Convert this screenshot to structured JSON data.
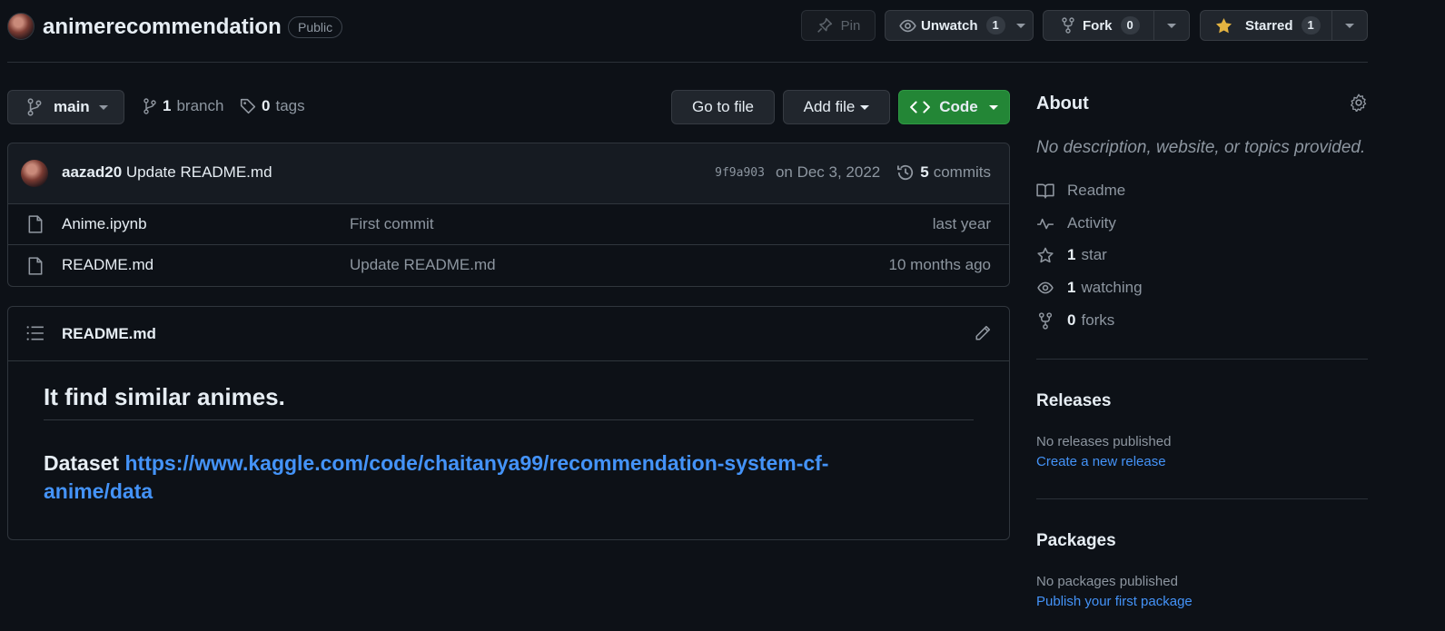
{
  "repo": {
    "name": "animerecommendation",
    "visibility": "Public"
  },
  "header_actions": {
    "pin_label": "Pin",
    "unwatch_label": "Unwatch",
    "unwatch_count": "1",
    "fork_label": "Fork",
    "fork_count": "0",
    "starred_label": "Starred",
    "starred_count": "1"
  },
  "branch_bar": {
    "branch": "main",
    "branch_count": "1",
    "branch_word": "branch",
    "tag_count": "0",
    "tag_word": "tags",
    "go_to_file": "Go to file",
    "add_file": "Add file",
    "code": "Code"
  },
  "latest_commit": {
    "author": "aazad20",
    "message": "Update README.md",
    "sha": "9f9a903",
    "date": "on Dec 3, 2022",
    "commit_count": "5",
    "commit_word": "commits"
  },
  "files": [
    {
      "name": "Anime.ipynb",
      "message": "First commit",
      "age": "last year"
    },
    {
      "name": "README.md",
      "message": "Update README.md",
      "age": "10 months ago"
    }
  ],
  "readme": {
    "filename": "README.md",
    "heading": "It find similar animes.",
    "dataset_label": "Dataset",
    "dataset_link_line1": "https://www.kaggle.com/code/chaitanya99/recommendation-system-cf-",
    "dataset_link_line2": "anime/data"
  },
  "about": {
    "title": "About",
    "description": "No description, website, or topics provided.",
    "readme": "Readme",
    "activity": "Activity",
    "stars_count": "1",
    "stars_word": "star",
    "watching_count": "1",
    "watching_word": "watching",
    "forks_count": "0",
    "forks_word": "forks"
  },
  "releases": {
    "title": "Releases",
    "empty": "No releases published",
    "action": "Create a new release"
  },
  "packages": {
    "title": "Packages",
    "empty": "No packages published",
    "action": "Publish your first package"
  },
  "colors": {
    "background": "#0d1117",
    "link": "#4493f8",
    "code_button": "#238636",
    "star": "#e3b341"
  }
}
